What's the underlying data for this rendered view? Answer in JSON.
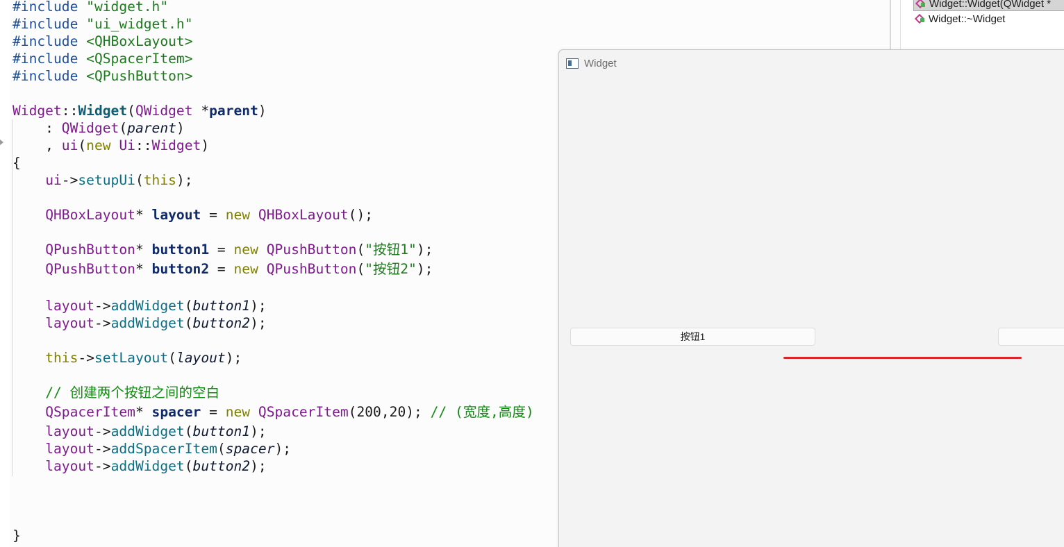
{
  "editor": {
    "lines": [
      [
        {
          "c": "pp",
          "t": "#include "
        },
        {
          "c": "str",
          "t": "\"widget.h\""
        }
      ],
      [
        {
          "c": "pp",
          "t": "#include "
        },
        {
          "c": "str",
          "t": "\"ui_widget.h\""
        }
      ],
      [
        {
          "c": "pp",
          "t": "#include "
        },
        {
          "c": "str",
          "t": "<QHBoxLayout>"
        }
      ],
      [
        {
          "c": "pp",
          "t": "#include "
        },
        {
          "c": "str",
          "t": "<QSpacerItem>"
        }
      ],
      [
        {
          "c": "pp",
          "t": "#include "
        },
        {
          "c": "str",
          "t": "<QPushButton>"
        }
      ],
      [],
      [
        {
          "c": "type",
          "t": "Widget"
        },
        {
          "c": "txt",
          "t": "::"
        },
        {
          "c": "fnbold",
          "t": "Widget"
        },
        {
          "c": "txt",
          "t": "("
        },
        {
          "c": "type",
          "t": "QWidget"
        },
        {
          "c": "txt",
          "t": " *"
        },
        {
          "c": "var",
          "t": "parent"
        },
        {
          "c": "txt",
          "t": ")"
        }
      ],
      [
        {
          "c": "txt",
          "t": "    : "
        },
        {
          "c": "type",
          "t": "QWidget"
        },
        {
          "c": "txt",
          "t": "("
        },
        {
          "c": "par",
          "t": "parent"
        },
        {
          "c": "txt",
          "t": ")"
        }
      ],
      [
        {
          "c": "txt",
          "t": "    , "
        },
        {
          "c": "mem",
          "t": "ui"
        },
        {
          "c": "txt",
          "t": "("
        },
        {
          "c": "kw",
          "t": "new"
        },
        {
          "c": "txt",
          "t": " "
        },
        {
          "c": "type",
          "t": "Ui"
        },
        {
          "c": "txt",
          "t": "::"
        },
        {
          "c": "type",
          "t": "Widget"
        },
        {
          "c": "txt",
          "t": ")"
        }
      ],
      [
        {
          "c": "txt",
          "t": "{"
        }
      ],
      [
        {
          "c": "txt",
          "t": "    "
        },
        {
          "c": "mem",
          "t": "ui"
        },
        {
          "c": "txt",
          "t": "->"
        },
        {
          "c": "fn",
          "t": "setupUi"
        },
        {
          "c": "txt",
          "t": "("
        },
        {
          "c": "kw",
          "t": "this"
        },
        {
          "c": "txt",
          "t": ");"
        }
      ],
      [],
      [
        {
          "c": "txt",
          "t": "    "
        },
        {
          "c": "type",
          "t": "QHBoxLayout"
        },
        {
          "c": "txt",
          "t": "* "
        },
        {
          "c": "var",
          "t": "layout"
        },
        {
          "c": "txt",
          "t": " = "
        },
        {
          "c": "kw",
          "t": "new"
        },
        {
          "c": "txt",
          "t": " "
        },
        {
          "c": "type",
          "t": "QHBoxLayout"
        },
        {
          "c": "txt",
          "t": "();"
        }
      ],
      [],
      [
        {
          "c": "txt",
          "t": "    "
        },
        {
          "c": "type",
          "t": "QPushButton"
        },
        {
          "c": "txt",
          "t": "* "
        },
        {
          "c": "var",
          "t": "button1"
        },
        {
          "c": "txt",
          "t": " = "
        },
        {
          "c": "kw",
          "t": "new"
        },
        {
          "c": "txt",
          "t": " "
        },
        {
          "c": "type",
          "t": "QPushButton"
        },
        {
          "c": "txt",
          "t": "("
        },
        {
          "c": "str",
          "t": "\"按钮1\""
        },
        {
          "c": "txt",
          "t": ");"
        }
      ],
      [
        {
          "c": "txt",
          "t": "    "
        },
        {
          "c": "type",
          "t": "QPushButton"
        },
        {
          "c": "txt",
          "t": "* "
        },
        {
          "c": "var",
          "t": "button2"
        },
        {
          "c": "txt",
          "t": " = "
        },
        {
          "c": "kw",
          "t": "new"
        },
        {
          "c": "txt",
          "t": " "
        },
        {
          "c": "type",
          "t": "QPushButton"
        },
        {
          "c": "txt",
          "t": "("
        },
        {
          "c": "str",
          "t": "\"按钮2\""
        },
        {
          "c": "txt",
          "t": ");"
        }
      ],
      [],
      [
        {
          "c": "txt",
          "t": "    "
        },
        {
          "c": "type",
          "t": "layout"
        },
        {
          "c": "txt",
          "t": "->"
        },
        {
          "c": "fn",
          "t": "addWidget"
        },
        {
          "c": "txt",
          "t": "("
        },
        {
          "c": "par",
          "t": "button1"
        },
        {
          "c": "txt",
          "t": ");"
        }
      ],
      [
        {
          "c": "txt",
          "t": "    "
        },
        {
          "c": "type",
          "t": "layout"
        },
        {
          "c": "txt",
          "t": "->"
        },
        {
          "c": "fn",
          "t": "addWidget"
        },
        {
          "c": "txt",
          "t": "("
        },
        {
          "c": "par",
          "t": "button2"
        },
        {
          "c": "txt",
          "t": ");"
        }
      ],
      [],
      [
        {
          "c": "txt",
          "t": "    "
        },
        {
          "c": "kw",
          "t": "this"
        },
        {
          "c": "txt",
          "t": "->"
        },
        {
          "c": "fn",
          "t": "setLayout"
        },
        {
          "c": "txt",
          "t": "("
        },
        {
          "c": "par",
          "t": "layout"
        },
        {
          "c": "txt",
          "t": ");"
        }
      ],
      [],
      [
        {
          "c": "txt",
          "t": "    "
        },
        {
          "c": "cmt",
          "t": "// 创建两个按钮之间的空白"
        }
      ],
      [
        {
          "c": "txt",
          "t": "    "
        },
        {
          "c": "type",
          "t": "QSpacerItem"
        },
        {
          "c": "txt",
          "t": "* "
        },
        {
          "c": "var",
          "t": "spacer"
        },
        {
          "c": "txt",
          "t": " = "
        },
        {
          "c": "kw",
          "t": "new"
        },
        {
          "c": "txt",
          "t": " "
        },
        {
          "c": "type",
          "t": "QSpacerItem"
        },
        {
          "c": "txt",
          "t": "(200,20); "
        },
        {
          "c": "cmt",
          "t": "// (宽度,高度)"
        }
      ],
      [
        {
          "c": "txt",
          "t": "    "
        },
        {
          "c": "type",
          "t": "layout"
        },
        {
          "c": "txt",
          "t": "->"
        },
        {
          "c": "fn",
          "t": "addWidget"
        },
        {
          "c": "txt",
          "t": "("
        },
        {
          "c": "par",
          "t": "button1"
        },
        {
          "c": "txt",
          "t": ");"
        }
      ],
      [
        {
          "c": "txt",
          "t": "    "
        },
        {
          "c": "type",
          "t": "layout"
        },
        {
          "c": "txt",
          "t": "->"
        },
        {
          "c": "fn",
          "t": "addSpacerItem"
        },
        {
          "c": "txt",
          "t": "("
        },
        {
          "c": "par",
          "t": "spacer"
        },
        {
          "c": "txt",
          "t": ");"
        }
      ],
      [
        {
          "c": "txt",
          "t": "    "
        },
        {
          "c": "type",
          "t": "layout"
        },
        {
          "c": "txt",
          "t": "->"
        },
        {
          "c": "fn",
          "t": "addWidget"
        },
        {
          "c": "txt",
          "t": "("
        },
        {
          "c": "par",
          "t": "button2"
        },
        {
          "c": "txt",
          "t": ");"
        }
      ],
      [],
      [],
      [],
      [
        {
          "c": "txt",
          "t": "}"
        }
      ]
    ]
  },
  "outline": {
    "items": [
      {
        "label": "Widget::Widget(QWidget *",
        "icon": "method-icon",
        "selected": true
      },
      {
        "label": "Widget::~Widget",
        "icon": "method-icon",
        "selected": false
      }
    ]
  },
  "widget_window": {
    "title": "Widget",
    "icon": "window-icon",
    "button1_label": "按钮1",
    "button2_label": "",
    "annotation_color": "#d8262a"
  }
}
